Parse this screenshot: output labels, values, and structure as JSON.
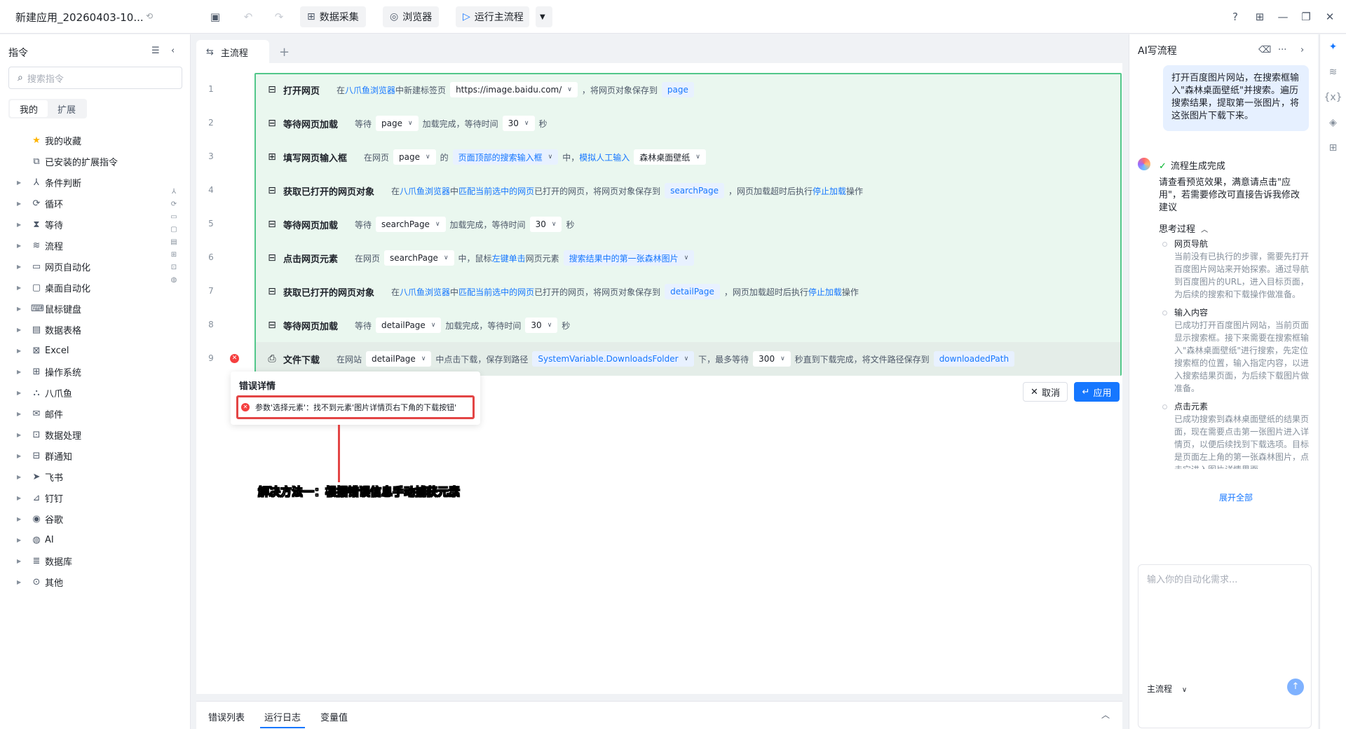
{
  "header": {
    "app_title": "新建应用_20260403-10...",
    "buttons": {
      "data_collect": "数据采集",
      "browser": "浏览器",
      "run_main": "运行主流程"
    }
  },
  "sidebar": {
    "title": "指令",
    "search_placeholder": "搜索指令",
    "tabs": [
      "我的",
      "扩展"
    ],
    "items": [
      {
        "label": "我的收藏",
        "icon": "star-icon"
      },
      {
        "label": "已安装的扩展指令",
        "icon": "puzzle-icon"
      },
      {
        "label": "条件判断",
        "icon": "branch-icon"
      },
      {
        "label": "循环",
        "icon": "loop-icon"
      },
      {
        "label": "等待",
        "icon": "hourglass-icon"
      },
      {
        "label": "流程",
        "icon": "flow-icon"
      },
      {
        "label": "网页自动化",
        "icon": "webpage-icon"
      },
      {
        "label": "桌面自动化",
        "icon": "desktop-icon"
      },
      {
        "label": "鼠标键盘",
        "icon": "keyboard-icon"
      },
      {
        "label": "数据表格",
        "icon": "table-icon"
      },
      {
        "label": "Excel",
        "icon": "excel-icon"
      },
      {
        "label": "操作系统",
        "icon": "os-icon"
      },
      {
        "label": "八爪鱼",
        "icon": "octopus-icon"
      },
      {
        "label": "邮件",
        "icon": "mail-icon"
      },
      {
        "label": "数据处理",
        "icon": "data-process-icon"
      },
      {
        "label": "群通知",
        "icon": "notify-icon"
      },
      {
        "label": "飞书",
        "icon": "feishu-icon"
      },
      {
        "label": "钉钉",
        "icon": "dingtalk-icon"
      },
      {
        "label": "谷歌",
        "icon": "google-icon"
      },
      {
        "label": "AI",
        "icon": "ai-icon"
      },
      {
        "label": "数据库",
        "icon": "database-icon"
      },
      {
        "label": "其他",
        "icon": "more-icon"
      }
    ]
  },
  "editor": {
    "tab": "主流程",
    "rows": [
      {
        "n": "1",
        "cmd": "打开网页",
        "t1": "在",
        "l1": "八爪鱼浏览器",
        "t2": "中新建标签页",
        "c1": "https://image.baidu.com/",
        "t3": "，将网页对象保存到",
        "v1": "page"
      },
      {
        "n": "2",
        "cmd": "等待网页加载",
        "t1": "等待",
        "c1": "page",
        "t2": "加载完成，等待时间",
        "c2": "30",
        "t3": "秒"
      },
      {
        "n": "3",
        "cmd": "填写网页输入框",
        "t1": "在网页",
        "c1": "page",
        "t2": "的",
        "c2": "页面顶部的搜索输入框",
        "t3": "中，",
        "l1": "模拟人工输入",
        "c3": "森林桌面壁纸"
      },
      {
        "n": "4",
        "cmd": "获取已打开的网页对象",
        "t1": "在",
        "l1": "八爪鱼浏览器",
        "t2": "中",
        "l2": "匹配当前选中的网页",
        "t3": "已打开的网页，将网页对象保存到",
        "v1": "searchPage",
        "t4": "，网页加载超时后执行",
        "l3": "停止加载",
        "t5": "操作"
      },
      {
        "n": "5",
        "cmd": "等待网页加载",
        "t1": "等待",
        "c1": "searchPage",
        "t2": "加载完成，等待时间",
        "c2": "30",
        "t3": "秒"
      },
      {
        "n": "6",
        "cmd": "点击网页元素",
        "t1": "在网页",
        "c1": "searchPage",
        "t2": "中，鼠标",
        "l1": "左键单击",
        "t3": "网页元素",
        "c2": "搜索结果中的第一张森林图片"
      },
      {
        "n": "7",
        "cmd": "获取已打开的网页对象",
        "t1": "在",
        "l1": "八爪鱼浏览器",
        "t2": "中",
        "l2": "匹配当前选中的网页",
        "t3": "已打开的网页，将网页对象保存到",
        "v1": "detailPage",
        "t4": "，网页加载超时后执行",
        "l3": "停止加载",
        "t5": "操作"
      },
      {
        "n": "8",
        "cmd": "等待网页加载",
        "t1": "等待",
        "c1": "detailPage",
        "t2": "加载完成，等待时间",
        "c2": "30",
        "t3": "秒"
      },
      {
        "n": "9",
        "cmd": "文件下载",
        "t1": "在网站",
        "c1": "detailPage",
        "t2": "中点击下载，保存到路径",
        "c2": "SystemVariable.DownloadsFolder",
        "t3": "下，最多等待",
        "c3": "300",
        "t4": "秒直到下载完成，将文件路径保存到",
        "v1": "downloadedPath"
      }
    ],
    "error": {
      "title": "错误详情",
      "message": "参数'选择元素'：找不到元素'图片详情页右下角的下载按钮'"
    },
    "annotation": "解决方法一：根据错误信息手动捕获元素",
    "cancel": "取消",
    "apply": "应用"
  },
  "bottom": {
    "tabs": [
      "错误列表",
      "运行日志",
      "变量值"
    ],
    "active_tab": "运行日志"
  },
  "ai": {
    "title": "AI写流程",
    "user_msg": "打开百度图片网站，在搜索框输入\"森林桌面壁纸\"并搜索。遍历搜索结果，提取第一张图片，将这张图片下载下来。",
    "status": "流程生成完成",
    "reply": "请查看预览效果，满意请点击\"应用\"，若需要修改可直接告诉我修改建议",
    "think_label": "思考过程",
    "steps": [
      {
        "title": "网页导航",
        "text": "当前没有已执行的步骤，需要先打开百度图片网站来开始探索。通过导航到百度图片的URL，进入目标页面，为后续的搜索和下载操作做准备。"
      },
      {
        "title": "输入内容",
        "text": "已成功打开百度图片网站，当前页面显示搜索框。接下来需要在搜索框输入\"森林桌面壁纸\"进行搜索，先定位搜索框的位置，输入指定内容，以进入搜索结果页面，为后续下载图片做准备。"
      },
      {
        "title": "点击元素",
        "text": "已成功搜索到森林桌面壁纸的结果页面，现在需要点击第一张图片进入详情页，以便后续找到下载选项。目标是页面左上角的第一张森林图片，点击它进入图片详情界面。"
      }
    ],
    "expand_all": "展开全部",
    "input_placeholder": "输入你的自动化需求...",
    "flow_select": "主流程"
  },
  "colors": {
    "accent": "#1677ff",
    "success_bg": "#eaf7ef",
    "success_border": "#52c78a",
    "error": "#e34545"
  }
}
